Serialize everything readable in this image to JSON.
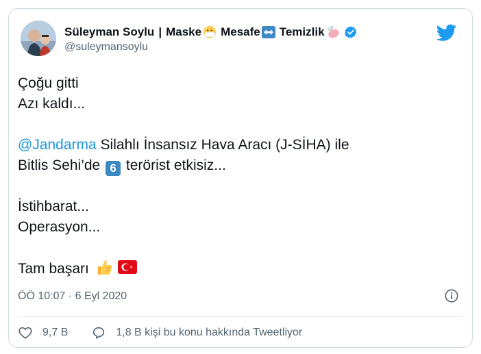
{
  "author": {
    "name": "Süleyman Soylu",
    "separator": "|",
    "tag_1": "Maske",
    "tag_2": "Mesafe",
    "tag_3": "Temizlik",
    "handle": "@suleymansoylu",
    "verified": true
  },
  "tweet": {
    "lines": [
      "Çoğu gitti",
      "Azı kaldı...",
      "",
      "Silahlı İnsansız Hava Aracı (J-SİHA) ile",
      "Bitlis Sehi’de",
      "terörist etkisiz...",
      "",
      "İstihbarat...",
      "Operasyon...",
      "",
      "Tam başarı"
    ],
    "mention": "@Jandarma",
    "keycap_number": "6"
  },
  "meta": {
    "timestamp": "ÖÖ 10:07 · 6 Eyl 2020"
  },
  "actions": {
    "likes": "9,7 B",
    "replies": "1,8 B kişi bu konu hakkında Tweetliyor"
  },
  "colors": {
    "accent": "#1b95e0",
    "text": "#0f1419",
    "muted": "#536471",
    "border": "#cfd9de"
  }
}
